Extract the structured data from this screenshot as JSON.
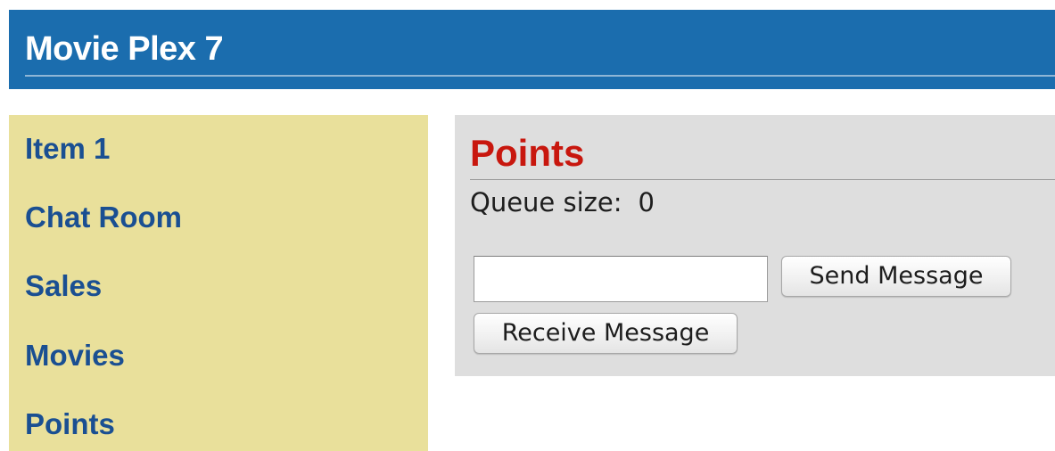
{
  "header": {
    "title": "Movie Plex 7"
  },
  "sidebar": {
    "items": [
      {
        "label": "Item 1"
      },
      {
        "label": "Chat Room"
      },
      {
        "label": "Sales"
      },
      {
        "label": "Movies"
      },
      {
        "label": "Points"
      }
    ]
  },
  "main": {
    "title": "Points",
    "queue_label": "Queue size:",
    "queue_value": "0",
    "message_input": {
      "value": "",
      "placeholder": ""
    },
    "send_button_label": "Send Message",
    "receive_button_label": "Receive Message"
  },
  "colors": {
    "header_bg": "#1b6dae",
    "sidebar_bg": "#e9e09b",
    "sidebar_link": "#1a4f92",
    "content_bg": "#dedede",
    "content_title": "#c8170e"
  }
}
